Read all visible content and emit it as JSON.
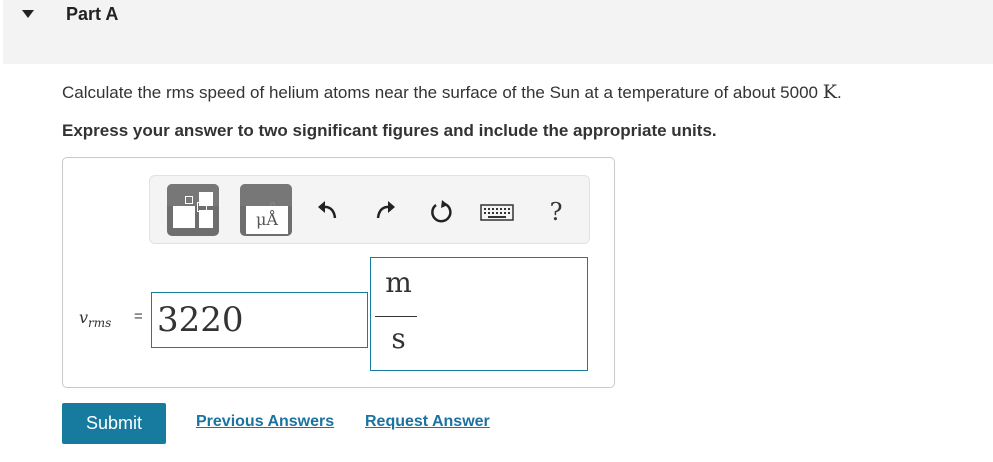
{
  "part": {
    "title": "Part A"
  },
  "question": {
    "text": "Calculate the rms speed of helium atoms near the surface of the Sun at a temperature of about 5000",
    "unit": "K",
    "end": "."
  },
  "instruction": "Express your answer to two significant figures and include the appropriate units.",
  "toolbar": {
    "templates_icon": "templates-icon",
    "units_label": "μÅ",
    "undo_icon": "undo-icon",
    "redo_icon": "redo-icon",
    "reset_icon": "reset-icon",
    "keyboard_icon": "keyboard-icon",
    "help_label": "?"
  },
  "answer": {
    "variable": "v",
    "variable_sub": "rms",
    "equals": "=",
    "value": "3220",
    "unit_numerator": "m",
    "unit_denominator": "s"
  },
  "actions": {
    "submit_label": "Submit",
    "previous_answers_label": "Previous Answers",
    "request_answer_label": "Request Answer"
  },
  "colors": {
    "accent": "#167b9e",
    "link": "#1a73a0",
    "toolbar_button": "#6e6e6e"
  }
}
